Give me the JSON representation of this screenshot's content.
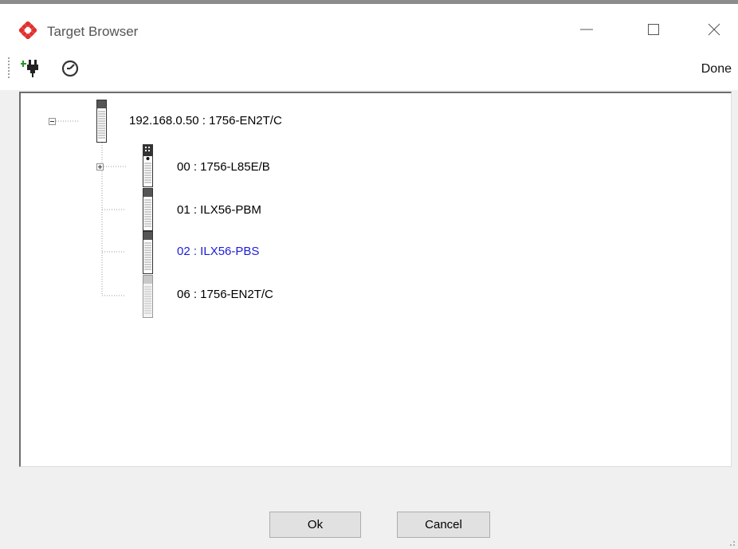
{
  "window": {
    "title": "Target Browser",
    "app_icon": "red-diamond-grid-icon",
    "controls": [
      "minimize-icon",
      "maximize-icon",
      "close-icon"
    ]
  },
  "toolbar": {
    "buttons": [
      "connect-plug-icon",
      "gauge-icon"
    ],
    "done_label": "Done"
  },
  "tree": {
    "root": {
      "label": "192.168.0.50 : 1756-EN2T/C",
      "expanded": true,
      "children": [
        {
          "label": "00 : 1756-L85E/B",
          "expandable": true,
          "icon": "controller-module-icon"
        },
        {
          "label": "01 : ILX56-PBM",
          "expandable": false,
          "icon": "module-icon"
        },
        {
          "label": "02 : ILX56-PBS",
          "expandable": false,
          "icon": "module-icon",
          "selected": true
        },
        {
          "label": "06 : 1756-EN2T/C",
          "expandable": false,
          "icon": "module-icon-dim"
        }
      ]
    }
  },
  "buttons": {
    "ok_label": "Ok",
    "cancel_label": "Cancel"
  },
  "colors": {
    "selected_text": "#1c1cd8",
    "app_icon": "#e0302f"
  }
}
